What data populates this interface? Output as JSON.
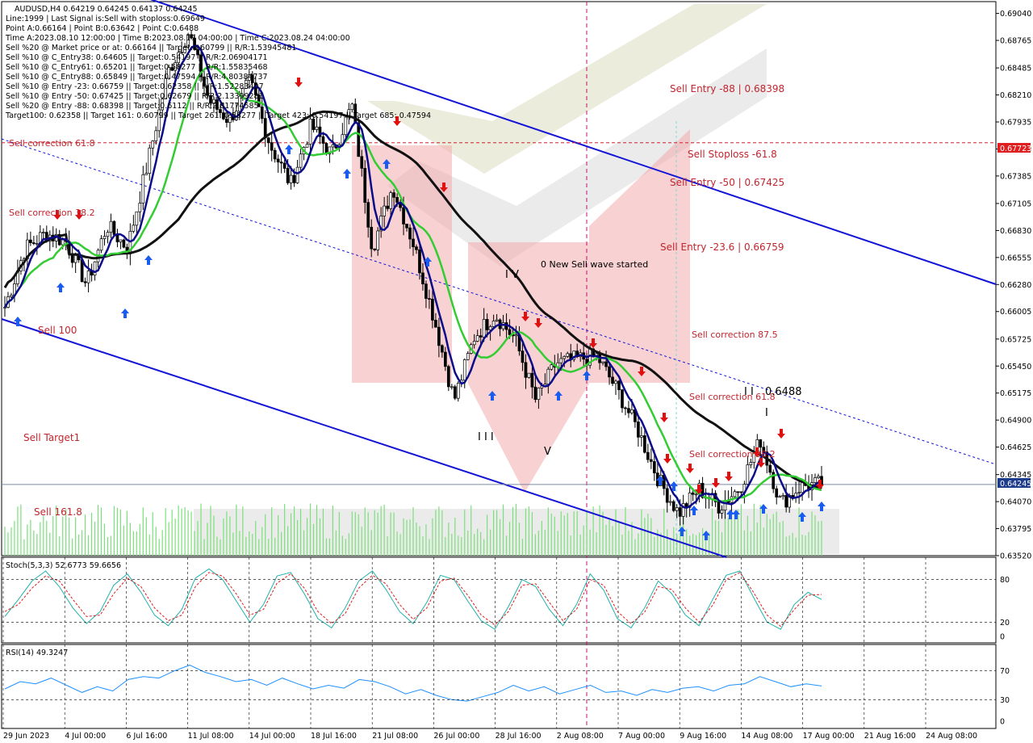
{
  "header": {
    "symbol_line": "AUDUSD,H4  0.64219 0.64245 0.64137 0.64245",
    "info_lines": [
      "Line:1999 | Last Signal is:Sell with stoploss:0.69649",
      "Point A:0.66164 | Point B:0.63642 | Point C:0.6488",
      "Time A:2023.08.10 12:00:00 | Time B:2023.08.17 04:00:00 | Time C:2023.08.24 04:00:00",
      "Sell %20 @ Market price or at: 0.66164 || Target:0.60799 || R/R:1.53945481",
      "Sell %10 @ C_Entry38: 0.64605 || Target:0.54197 || R/R:2.06904171",
      "Sell %10 @ C_Entry61: 0.65201 || Target:0.58277 || R/R:1.55835468",
      "Sell %10 @ C_Entry88: 0.65849 || Target:0.47594 || R/R:4.80384737",
      "Sell %10 @ Entry -23: 0.66759 || Target:0.62358 || R/R:1.52283407",
      "Sell %10 @ Entry -50: 0.67425 || Target:0.62679 || R/R:2.13399281",
      "Sell %20 @ Entry -88: 0.68398 || Target:0.6112 || R/R:2.81774585",
      "Target100: 0.62358 || Target 161: 0.60799 || Target 261: 0.58277 || Target 423: 0.54197 || Target 685: 0.47594"
    ]
  },
  "chart_data": [
    {
      "type": "candlestick",
      "panel": "main",
      "symbol": "AUDUSD",
      "timeframe": "H4",
      "ohlc_last": {
        "open": 0.64219,
        "high": 0.64245,
        "low": 0.64137,
        "close": 0.64245
      },
      "current_price": "0.64245",
      "stoploss_marker": "0.67723",
      "ylim": [
        0.6352,
        0.6916
      ],
      "y_ticks": [
        "0.69040",
        "0.68765",
        "0.68485",
        "0.68210",
        "0.67935",
        "0.67660",
        "0.67385",
        "0.67105",
        "0.66830",
        "0.66555",
        "0.66280",
        "0.66005",
        "0.65725",
        "0.65450",
        "0.65175",
        "0.64900",
        "0.64625",
        "0.64345",
        "0.64070",
        "0.63795",
        "0.63520"
      ],
      "x_ticks": [
        "29 Jun 2023",
        "4 Jul 00:00",
        "6 Jul 16:00",
        "11 Jul 08:00",
        "14 Jul 00:00",
        "18 Jul 16:00",
        "21 Jul 08:00",
        "26 Jul 00:00",
        "28 Jul 16:00",
        "2 Aug 08:00",
        "7 Aug 00:00",
        "9 Aug 16:00",
        "14 Aug 08:00",
        "17 Aug 00:00",
        "21 Aug 16:00",
        "24 Aug 08:00"
      ],
      "close_path": [
        {
          "x": "29 Jun 2023",
          "y": 0.6605
        },
        {
          "x": "3 Jul 12:00",
          "y": 0.6665
        },
        {
          "x": "4 Jul 00:00",
          "y": 0.668
        },
        {
          "x": "5 Jul 12:00",
          "y": 0.6672
        },
        {
          "x": "6 Jul 16:00",
          "y": 0.6628
        },
        {
          "x": "7 Jul 12:00",
          "y": 0.6688
        },
        {
          "x": "10 Jul 12:00",
          "y": 0.6665
        },
        {
          "x": "11 Jul 08:00",
          "y": 0.6752
        },
        {
          "x": "12 Jul 12:00",
          "y": 0.6845
        },
        {
          "x": "13 Jul 08:00",
          "y": 0.6885
        },
        {
          "x": "14 Jul 00:00",
          "y": 0.6815
        },
        {
          "x": "17 Jul 12:00",
          "y": 0.6795
        },
        {
          "x": "18 Jul 16:00",
          "y": 0.6835
        },
        {
          "x": "19 Jul 12:00",
          "y": 0.677
        },
        {
          "x": "21 Jul 08:00",
          "y": 0.673
        },
        {
          "x": "25 Jul 00:00",
          "y": 0.679
        },
        {
          "x": "26 Jul 00:00",
          "y": 0.676
        },
        {
          "x": "26 Jul 16:00",
          "y": 0.681
        },
        {
          "x": "27 Jul 16:00",
          "y": 0.6665
        },
        {
          "x": "28 Jul 16:00",
          "y": 0.6728
        },
        {
          "x": "31 Jul 16:00",
          "y": 0.667
        },
        {
          "x": "1 Aug 12:00",
          "y": 0.6595
        },
        {
          "x": "2 Aug 08:00",
          "y": 0.651
        },
        {
          "x": "3 Aug 12:00",
          "y": 0.6575
        },
        {
          "x": "4 Aug 12:00",
          "y": 0.6598
        },
        {
          "x": "7 Aug 00:00",
          "y": 0.6572
        },
        {
          "x": "8 Aug 08:00",
          "y": 0.651
        },
        {
          "x": "9 Aug 04:00",
          "y": 0.6548
        },
        {
          "x": "9 Aug 16:00",
          "y": 0.6552
        },
        {
          "x": "10 Aug 12:00",
          "y": 0.6555
        },
        {
          "x": "11 Aug 08:00",
          "y": 0.652
        },
        {
          "x": "14 Aug 08:00",
          "y": 0.648
        },
        {
          "x": "15 Aug 12:00",
          "y": 0.643
        },
        {
          "x": "17 Aug 00:00",
          "y": 0.6395
        },
        {
          "x": "17 Aug 16:00",
          "y": 0.642
        },
        {
          "x": "18 Aug 12:00",
          "y": 0.6402
        },
        {
          "x": "21 Aug 16:00",
          "y": 0.6422
        },
        {
          "x": "22 Aug 16:00",
          "y": 0.647
        },
        {
          "x": "23 Aug 12:00",
          "y": 0.6405
        },
        {
          "x": "24 Aug 08:00",
          "y": 0.6423
        },
        {
          "x": "25 Aug 00:00",
          "y": 0.6425
        }
      ],
      "levels": [
        {
          "label": "Sell Entry -88 | 0.68398",
          "price": 0.68398
        },
        {
          "label": "Sell Stoploss -61.8",
          "price": 0.67723
        },
        {
          "label": "Sell Entry -50 | 0.67425",
          "price": 0.67425
        },
        {
          "label": "Sell Entry -23.6 | 0.66759",
          "price": 0.66759
        },
        {
          "label": "Sell correction 87.5",
          "price": 0.6578
        },
        {
          "label": "Sell correction 61.8",
          "price": 0.6514
        },
        {
          "label": "Sell correction 38.2",
          "price": 0.6452
        },
        {
          "label": "Sell correction 61.8",
          "price": 0.677
        },
        {
          "label": "Sell correction 38.2",
          "price": 0.6703
        },
        {
          "label": "Sell 100",
          "price": 0.6575
        },
        {
          "label": "Sell Target1",
          "price": 0.6458
        },
        {
          "label": "Sell 161.8",
          "price": 0.6405
        }
      ],
      "wave_labels": [
        "I V",
        "I I I",
        "V",
        "I I",
        "I",
        "0 New Sell wave started",
        "0.6488"
      ]
    },
    {
      "type": "line",
      "panel": "stochastic",
      "title": "Stoch(5,3,3) 52.6773 59.6656",
      "ylim": [
        0,
        100
      ],
      "y_ticks": [
        "80",
        "20",
        "0"
      ],
      "series": [
        {
          "name": "main",
          "values": [
            28,
            52,
            78,
            92,
            70,
            40,
            18,
            35,
            72,
            88,
            62,
            30,
            15,
            38,
            82,
            95,
            80,
            50,
            20,
            45,
            85,
            90,
            60,
            25,
            12,
            40,
            78,
            92,
            66,
            35,
            18,
            48,
            86,
            80,
            50,
            22,
            10,
            42,
            80,
            70,
            38,
            15,
            45,
            88,
            65,
            25,
            12,
            40,
            78,
            60,
            30,
            15,
            52,
            86,
            92,
            55,
            20,
            10,
            45,
            62,
            52
          ]
        },
        {
          "name": "signal",
          "values": [
            35,
            45,
            68,
            85,
            78,
            52,
            28,
            30,
            60,
            82,
            70,
            40,
            22,
            30,
            70,
            90,
            85,
            60,
            30,
            38,
            75,
            88,
            68,
            35,
            18,
            32,
            68,
            86,
            74,
            45,
            24,
            40,
            78,
            82,
            58,
            30,
            16,
            35,
            72,
            74,
            48,
            22,
            38,
            80,
            72,
            35,
            18,
            34,
            70,
            66,
            40,
            20,
            44,
            80,
            90,
            62,
            30,
            14,
            38,
            58,
            59
          ]
        }
      ]
    },
    {
      "type": "line",
      "panel": "rsi",
      "title": "RSI(14) 49.3247",
      "ylim": [
        0,
        100
      ],
      "y_ticks": [
        "70",
        "30",
        "0"
      ],
      "series": [
        {
          "name": "RSI",
          "values": [
            45,
            55,
            52,
            60,
            50,
            40,
            48,
            42,
            58,
            62,
            60,
            70,
            78,
            68,
            62,
            55,
            58,
            50,
            60,
            52,
            45,
            50,
            46,
            58,
            55,
            48,
            38,
            44,
            36,
            30,
            28,
            34,
            40,
            50,
            42,
            48,
            38,
            44,
            50,
            40,
            42,
            36,
            44,
            40,
            46,
            48,
            42,
            50,
            52,
            62,
            55,
            48,
            52,
            49
          ]
        }
      ]
    }
  ],
  "colors": {
    "fast_ma": "#0b0b8a",
    "mid_ma": "#33cc33",
    "slow_ma": "#111111",
    "channel": "#1414d6",
    "buy_arrow": "#1a5cf0",
    "sell_arrow": "#e01010",
    "level_text": "#c0262e",
    "stoch_main": "#20b2aa",
    "stoch_signal": "#e02020",
    "rsi": "#1e90ff",
    "price_tag": "#e02020",
    "current_tag": "#1e3c8c"
  }
}
